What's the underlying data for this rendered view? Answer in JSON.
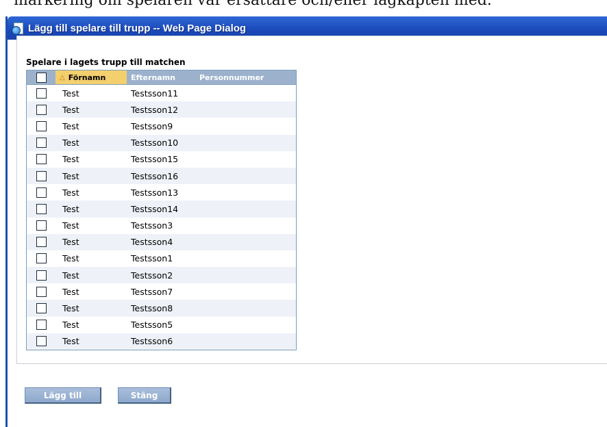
{
  "document": {
    "text_above": "markering om spelaren var ersättare och/eller lagkapten med."
  },
  "window": {
    "title": "Lägg till spelare till trupp -- Web Page Dialog"
  },
  "section": {
    "label": "Spelare i lagets trupp till matchen"
  },
  "grid": {
    "columns": {
      "first_name": "Förnamn",
      "last_name": "Efternamn",
      "personnummer": "Personnummer"
    },
    "sort_indicator": "sort-ascending-icon",
    "rows": [
      {
        "first": "Test",
        "last": "Testsson11",
        "pnr": ""
      },
      {
        "first": "Test",
        "last": "Testsson12",
        "pnr": ""
      },
      {
        "first": "Test",
        "last": "Testsson9",
        "pnr": ""
      },
      {
        "first": "Test",
        "last": "Testsson10",
        "pnr": ""
      },
      {
        "first": "Test",
        "last": "Testsson15",
        "pnr": ""
      },
      {
        "first": "Test",
        "last": "Testsson16",
        "pnr": ""
      },
      {
        "first": "Test",
        "last": "Testsson13",
        "pnr": ""
      },
      {
        "first": "Test",
        "last": "Testsson14",
        "pnr": ""
      },
      {
        "first": "Test",
        "last": "Testsson3",
        "pnr": ""
      },
      {
        "first": "Test",
        "last": "Testsson4",
        "pnr": ""
      },
      {
        "first": "Test",
        "last": "Testsson1",
        "pnr": ""
      },
      {
        "first": "Test",
        "last": "Testsson2",
        "pnr": ""
      },
      {
        "first": "Test",
        "last": "Testsson7",
        "pnr": ""
      },
      {
        "first": "Test",
        "last": "Testsson8",
        "pnr": ""
      },
      {
        "first": "Test",
        "last": "Testsson5",
        "pnr": ""
      },
      {
        "first": "Test",
        "last": "Testsson6",
        "pnr": ""
      }
    ]
  },
  "buttons": {
    "add_label": "Lägg till",
    "close_label": "Stäng"
  },
  "colors": {
    "titlebar": "#1a48b8",
    "grid_header": "#9cb2cc",
    "sorted_column": "#f3cf6d",
    "button": "#9db4d5"
  }
}
